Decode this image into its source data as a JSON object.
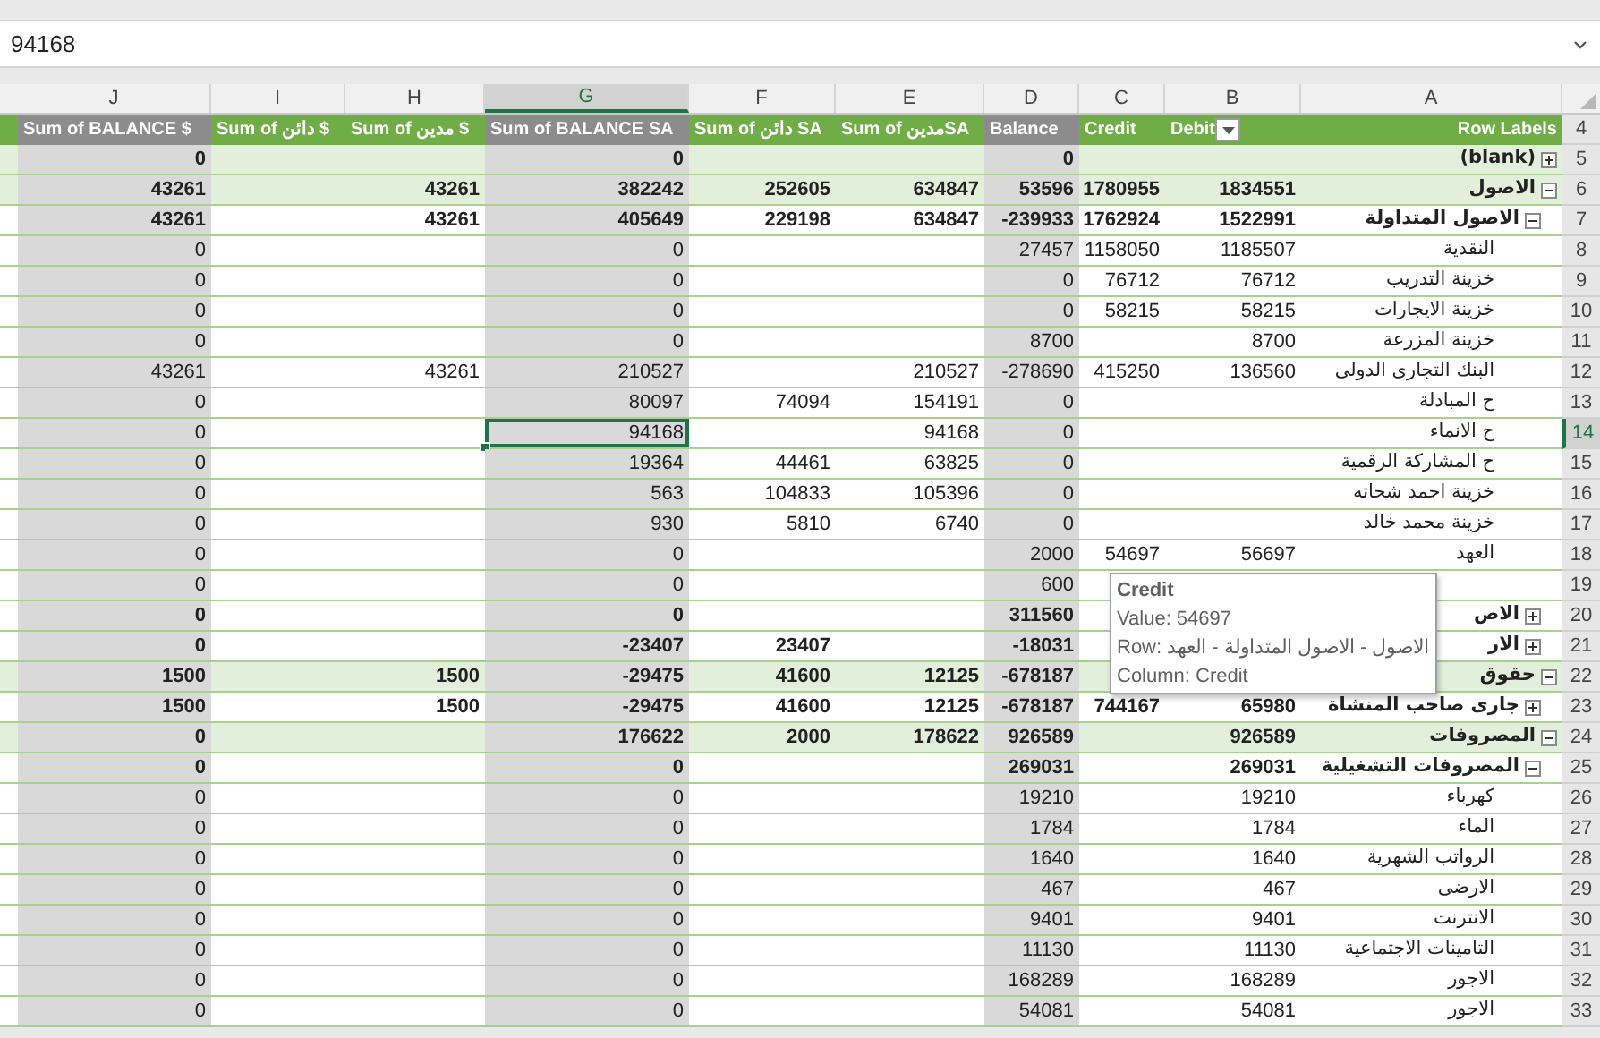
{
  "formula_bar": {
    "value": "94168"
  },
  "columns": [
    {
      "letter": "J",
      "header": "Sum of BALANCE $",
      "shaded": true,
      "selected": false,
      "filter_button": false
    },
    {
      "letter": "I",
      "header": "Sum of دائن $",
      "shaded": false,
      "selected": false,
      "filter_button": false
    },
    {
      "letter": "H",
      "header": "Sum of مدين $",
      "shaded": false,
      "selected": false,
      "filter_button": false
    },
    {
      "letter": "G",
      "header": "Sum of BALANCE SA",
      "shaded": true,
      "selected": true,
      "filter_button": false
    },
    {
      "letter": "F",
      "header": "Sum of دائن SA",
      "shaded": false,
      "selected": false,
      "filter_button": false
    },
    {
      "letter": "E",
      "header": "Sum of مدينSA",
      "shaded": false,
      "selected": false,
      "filter_button": false
    },
    {
      "letter": "D",
      "header": "Balance",
      "shaded": true,
      "selected": false,
      "filter_button": false
    },
    {
      "letter": "C",
      "header": "Credit",
      "shaded": false,
      "selected": false,
      "filter_button": false
    },
    {
      "letter": "B",
      "header": "Debit",
      "shaded": false,
      "selected": false,
      "filter_button": true
    },
    {
      "letter": "A",
      "header": "Row Labels",
      "shaded": false,
      "selected": false,
      "filter_button": false
    }
  ],
  "header_row_number": "4",
  "rows": [
    {
      "num": "5",
      "label": "(blank)",
      "expanded": false,
      "selected": false,
      "cells": {
        "J": "0",
        "G": "0",
        "D": "0"
      }
    },
    {
      "num": "6",
      "label": "الاصول",
      "expanded": true,
      "selected": false,
      "cells": {
        "J": "43261",
        "H": "43261",
        "G": "382242",
        "F": "252605",
        "E": "634847",
        "D": "53596",
        "C": "1780955",
        "B": "1834551"
      },
      "children": [
        {
          "num": "7",
          "label": "الاصول المتداولة",
          "expanded": true,
          "selected": false,
          "cells": {
            "J": "43261",
            "H": "43261",
            "G": "405649",
            "F": "229198",
            "E": "634847",
            "D": "-239933",
            "C": "1762924",
            "B": "1522991"
          },
          "children": [
            {
              "num": "8",
              "label": "النقدية",
              "selected": false,
              "cells": {
                "J": "0",
                "G": "0",
                "D": "27457",
                "C": "1158050",
                "B": "1185507"
              }
            },
            {
              "num": "9",
              "label": "خزينة التدريب",
              "selected": false,
              "cells": {
                "J": "0",
                "G": "0",
                "D": "0",
                "C": "76712",
                "B": "76712"
              }
            },
            {
              "num": "10",
              "label": "خزينة الايجارات",
              "selected": false,
              "cells": {
                "J": "0",
                "G": "0",
                "D": "0",
                "C": "58215",
                "B": "58215"
              }
            },
            {
              "num": "11",
              "label": "خزينة المزرعة",
              "selected": false,
              "cells": {
                "J": "0",
                "G": "0",
                "D": "8700",
                "B": "8700"
              }
            },
            {
              "num": "12",
              "label": "البنك التجارى الدولى",
              "selected": false,
              "cells": {
                "J": "43261",
                "H": "43261",
                "G": "210527",
                "E": "210527",
                "D": "-278690",
                "C": "415250",
                "B": "136560"
              }
            },
            {
              "num": "13",
              "label": "ح المبادلة",
              "selected": false,
              "cells": {
                "J": "0",
                "G": "80097",
                "F": "74094",
                "E": "154191",
                "D": "0"
              }
            },
            {
              "num": "14",
              "label": "ح الانماء",
              "selected": true,
              "cells": {
                "J": "0",
                "G": "94168",
                "E": "94168",
                "D": "0"
              }
            },
            {
              "num": "15",
              "label": "ح المشاركة الرقمية",
              "selected": false,
              "cells": {
                "J": "0",
                "G": "19364",
                "F": "44461",
                "E": "63825",
                "D": "0"
              }
            },
            {
              "num": "16",
              "label": "خزينة احمد شحاته",
              "selected": false,
              "cells": {
                "J": "0",
                "G": "563",
                "F": "104833",
                "E": "105396",
                "D": "0"
              }
            },
            {
              "num": "17",
              "label": "خزينة محمد خالد",
              "selected": false,
              "cells": {
                "J": "0",
                "G": "930",
                "F": "5810",
                "E": "6740",
                "D": "0"
              }
            },
            {
              "num": "18",
              "label": "العهد",
              "selected": false,
              "cells": {
                "J": "0",
                "G": "0",
                "D": "2000",
                "C": "54697",
                "B": "56697"
              }
            },
            {
              "num": "19",
              "selected": false,
              "cells": {
                "J": "0",
                "G": "0",
                "D": "600"
              }
            }
          ]
        },
        {
          "num": "20",
          "label": "الاص",
          "expanded": false,
          "selected": false,
          "cells": {
            "J": "0",
            "G": "0",
            "D": "311560"
          }
        },
        {
          "num": "21",
          "label": "الار",
          "expanded": false,
          "selected": false,
          "cells": {
            "J": "0",
            "G": "-23407",
            "F": "23407",
            "D": "-18031"
          }
        }
      ]
    },
    {
      "num": "22",
      "label": "حقوق",
      "expanded": true,
      "selected": false,
      "cells": {
        "J": "1500",
        "H": "1500",
        "G": "-29475",
        "F": "41600",
        "E": "12125",
        "D": "-678187"
      },
      "children": [
        {
          "num": "23",
          "label": "جارى صاحب المنشاة",
          "expanded": false,
          "selected": false,
          "cells": {
            "J": "1500",
            "H": "1500",
            "G": "-29475",
            "F": "41600",
            "E": "12125",
            "D": "-678187",
            "C": "744167",
            "B": "65980"
          }
        }
      ]
    },
    {
      "num": "24",
      "label": "المصروفات",
      "expanded": true,
      "selected": false,
      "cells": {
        "J": "0",
        "G": "176622",
        "F": "2000",
        "E": "178622",
        "D": "926589",
        "B": "926589"
      },
      "children": [
        {
          "num": "25",
          "label": "المصروفات التشغيلية",
          "expanded": true,
          "selected": false,
          "cells": {
            "J": "0",
            "G": "0",
            "D": "269031",
            "B": "269031"
          },
          "children": [
            {
              "num": "26",
              "label": "كهرباء",
              "selected": false,
              "cells": {
                "J": "0",
                "G": "0",
                "D": "19210",
                "B": "19210"
              }
            },
            {
              "num": "27",
              "label": "الماء",
              "selected": false,
              "cells": {
                "J": "0",
                "G": "0",
                "D": "1784",
                "B": "1784"
              }
            },
            {
              "num": "28",
              "label": "الرواتب الشهرية",
              "selected": false,
              "cells": {
                "J": "0",
                "G": "0",
                "D": "1640",
                "B": "1640"
              }
            },
            {
              "num": "29",
              "label": "الارضى",
              "selected": false,
              "cells": {
                "J": "0",
                "G": "0",
                "D": "467",
                "B": "467"
              }
            },
            {
              "num": "30",
              "label": "الانترنت",
              "selected": false,
              "cells": {
                "J": "0",
                "G": "0",
                "D": "9401",
                "B": "9401"
              }
            },
            {
              "num": "31",
              "label": "التامينات الاجتماعية",
              "selected": false,
              "cells": {
                "J": "0",
                "G": "0",
                "D": "11130",
                "B": "11130"
              }
            },
            {
              "num": "32",
              "label": "الاجور",
              "selected": false,
              "cells": {
                "J": "0",
                "G": "0",
                "D": "168289",
                "B": "168289"
              }
            },
            {
              "num": "33",
              "label": "الاجور",
              "selected": false,
              "cells": {
                "J": "0",
                "G": "0",
                "D": "54081",
                "B": "54081"
              }
            }
          ]
        }
      ]
    }
  ],
  "tooltip": {
    "title": "Credit",
    "lines": [
      "Value: 54697",
      "Row: الاصول  -  الاصول المتداولة  -  العهد",
      "Column: Credit"
    ]
  }
}
